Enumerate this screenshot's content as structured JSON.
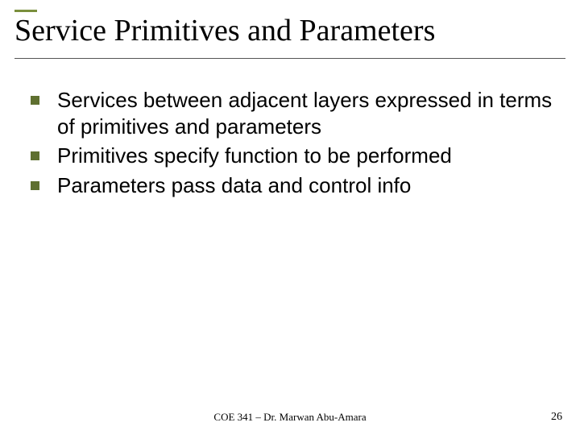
{
  "slide": {
    "title": "Service Primitives and Parameters",
    "bullets": [
      "Services between adjacent layers expressed in terms of primitives and parameters",
      "Primitives specify function to be performed",
      "Parameters pass data and control info"
    ],
    "footer_center": "COE 341 – Dr. Marwan Abu-Amara",
    "page_number": "26"
  }
}
